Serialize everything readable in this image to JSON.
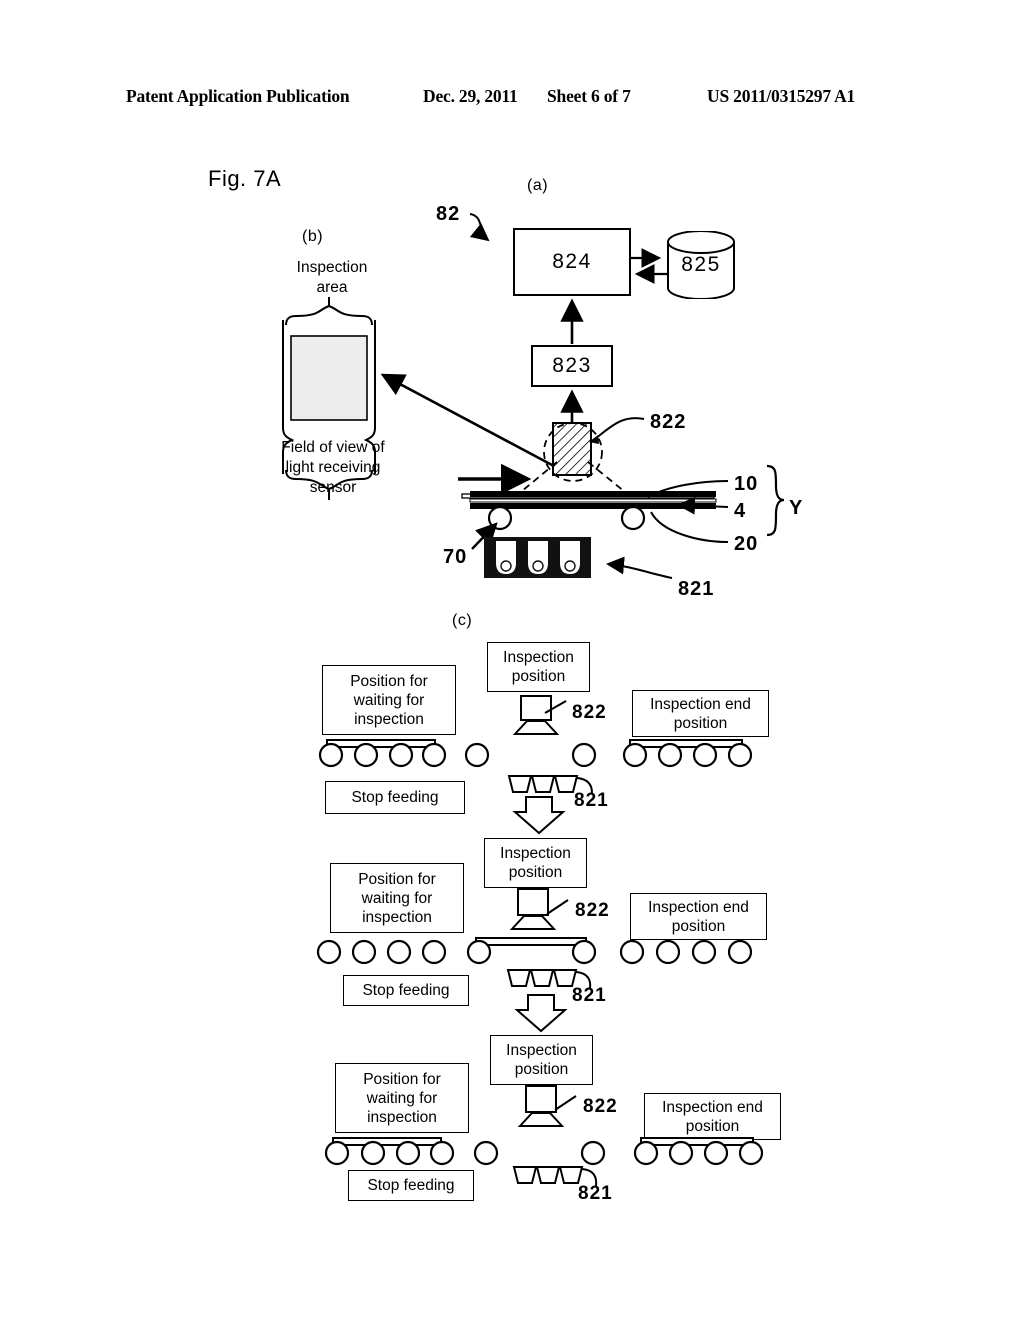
{
  "header": {
    "publication": "Patent Application Publication",
    "date": "Dec. 29, 2011",
    "sheet": "Sheet 6 of 7",
    "number": "US 2011/0315297 A1"
  },
  "figure": {
    "label": "Fig. 7A",
    "panels": {
      "a": "(a)",
      "b": "(b)",
      "c": "(c)"
    }
  },
  "panel_a": {
    "assembly_ref": "82",
    "blocks": {
      "processor": "824",
      "storage": "825",
      "converter": "823",
      "sensor": "822",
      "illuminator": "821"
    },
    "conveyor": {
      "roller_ref": "70",
      "layer_top": "10",
      "layer_mid": "4",
      "layer_bottom": "20",
      "bracket": "Y"
    }
  },
  "panel_b": {
    "top_caption": "Inspection\narea",
    "top_caption_line1": "Inspection",
    "top_caption_line2": "area",
    "bottom_caption_line1": "Field of view of",
    "bottom_caption_line2": "light receiving",
    "bottom_caption_line3": "sensor"
  },
  "panel_c": {
    "rows": [
      {
        "waiting_label": "Position for\nwaiting for\ninspection",
        "inspection_label": "Inspection\nposition",
        "end_label": "Inspection end\nposition",
        "stop_label": "Stop feeding",
        "sensor_ref": "822",
        "tray_ref": "821"
      },
      {
        "waiting_label": "Position for\nwaiting for\ninspection",
        "inspection_label": "Inspection\nposition",
        "end_label": "Inspection end\nposition",
        "stop_label": "Stop feeding",
        "sensor_ref": "822",
        "tray_ref": "821"
      },
      {
        "waiting_label": "Position for\nwaiting for\ninspection",
        "inspection_label": "Inspection\nposition",
        "end_label": "Inspection end\nposition",
        "stop_label": "Stop feeding",
        "sensor_ref": "822",
        "tray_ref": "821"
      }
    ]
  },
  "colors": {
    "ink": "#000000",
    "paper": "#ffffff",
    "fill_gray": "#e8e8e8"
  }
}
